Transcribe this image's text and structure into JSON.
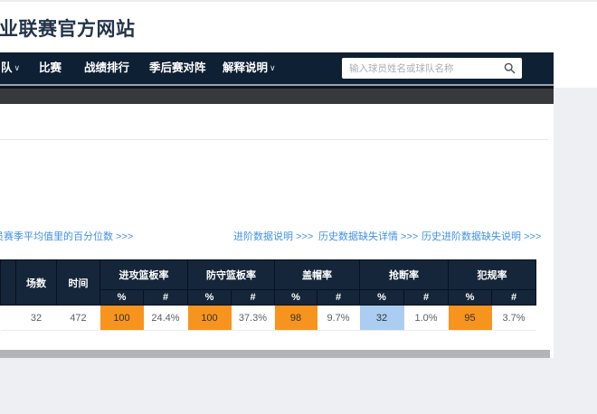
{
  "site": {
    "title": "业联赛官方网站"
  },
  "nav": {
    "bg": "#0e2033",
    "chevron": "∨",
    "items": [
      {
        "label": "队"
      },
      {
        "label": "比赛"
      },
      {
        "label": "战绩排行"
      },
      {
        "label": "季后赛对阵"
      },
      {
        "label": "解释说明"
      }
    ],
    "search_placeholder": "输入球员姓名或球队名称"
  },
  "links": {
    "color": "#4191e8",
    "percentile": "员赛季平均值里的百分位数 >>>",
    "advanced_info": "进阶数据说明 >>>",
    "history_missing": "历史数据缺失详情 >>>",
    "history_advanced_missing": "历史进阶数据缺失说明 >>>"
  },
  "table": {
    "header_bg": "#15263a",
    "col_games": "场数",
    "col_time": "时间",
    "groups": [
      {
        "label": "进攻篮板率"
      },
      {
        "label": "防守篮板率"
      },
      {
        "label": "盖帽率"
      },
      {
        "label": "抢断率"
      },
      {
        "label": "犯规率"
      }
    ],
    "sub_pct": "%",
    "sub_num": "#",
    "row": {
      "games": "32",
      "time": "472",
      "stats": [
        {
          "pct": "100",
          "pct_bg": "#f7941e",
          "num": "24.4%"
        },
        {
          "pct": "100",
          "pct_bg": "#f7941e",
          "num": "37.3%"
        },
        {
          "pct": "98",
          "pct_bg": "#f7941e",
          "num": "9.7%"
        },
        {
          "pct": "32",
          "pct_bg": "#abcdf1",
          "num": "1.0%"
        },
        {
          "pct": "95",
          "pct_bg": "#f7941e",
          "num": "3.7%"
        }
      ]
    }
  },
  "colors": {
    "orange_cell": "#f7941e",
    "blue_cell": "#abcdf1",
    "charcoal_bar": "#37393c",
    "page_gray": "#edeff3",
    "scrollbar_gray": "#b2b4b6"
  }
}
